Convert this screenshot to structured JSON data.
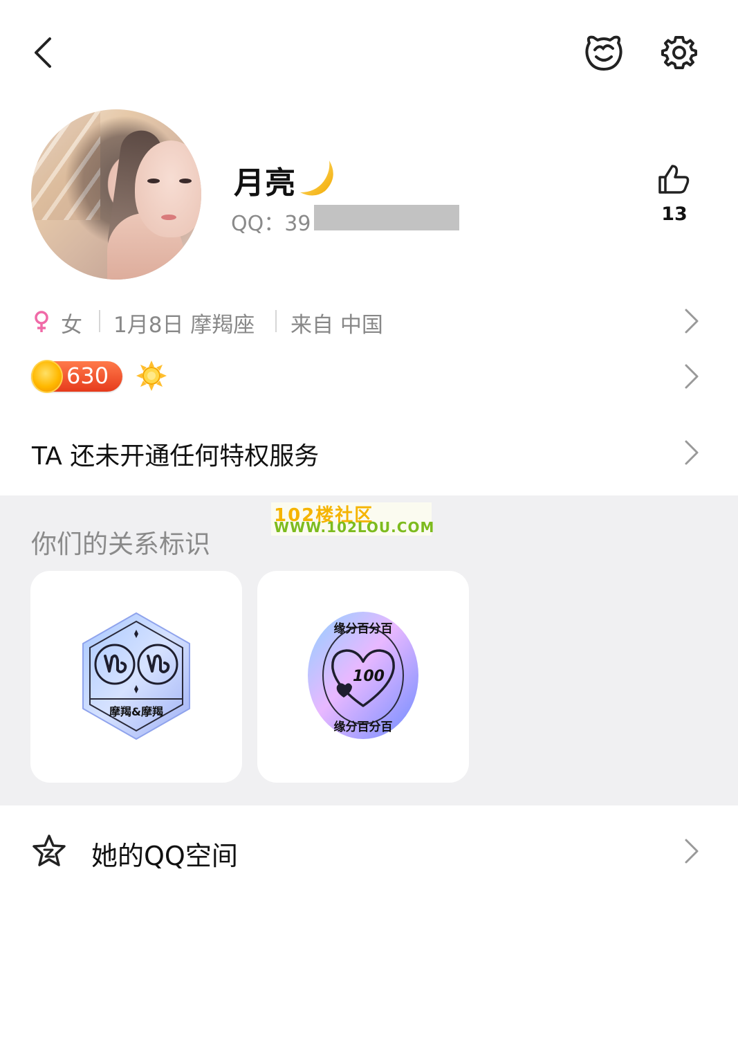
{
  "topbar": {
    "back_icon": "chevron-left-icon",
    "pet_icon": "pet-face-icon",
    "settings_icon": "gear-icon"
  },
  "profile": {
    "nickname": "月亮",
    "nickname_emoji": "crescent-moon-icon",
    "qq_label": "QQ：39",
    "qq_redacted": true,
    "like_count": "13",
    "like_icon": "thumbs-up-icon"
  },
  "info": {
    "gender_symbol": "♀",
    "gender": "女",
    "birthday_sign": "1月8日 摩羯座",
    "location": "来自 中国"
  },
  "level": {
    "value": "630",
    "badge_icon": "sun-level-icon"
  },
  "privilege": {
    "text": "TA 还未开通任何特权服务"
  },
  "relationship": {
    "title": "你们的关系标识",
    "badges": [
      {
        "name": "capricorn-pair-badge",
        "label": "摩羯&摩羯"
      },
      {
        "name": "match-100-badge",
        "top_text": "缘分百分百",
        "bottom_text": "缘分百分百",
        "score": "100"
      }
    ]
  },
  "watermark": {
    "line1": "102楼社区",
    "line2": "WWW.102LOU.COM"
  },
  "qzone": {
    "label": "她的QQ空间",
    "icon": "qzone-star-icon"
  },
  "colors": {
    "accent_orange": "#e63b1c",
    "female_pink": "#f06aa7",
    "section_gray": "#f0f0f2",
    "secondary_text": "#888888"
  }
}
